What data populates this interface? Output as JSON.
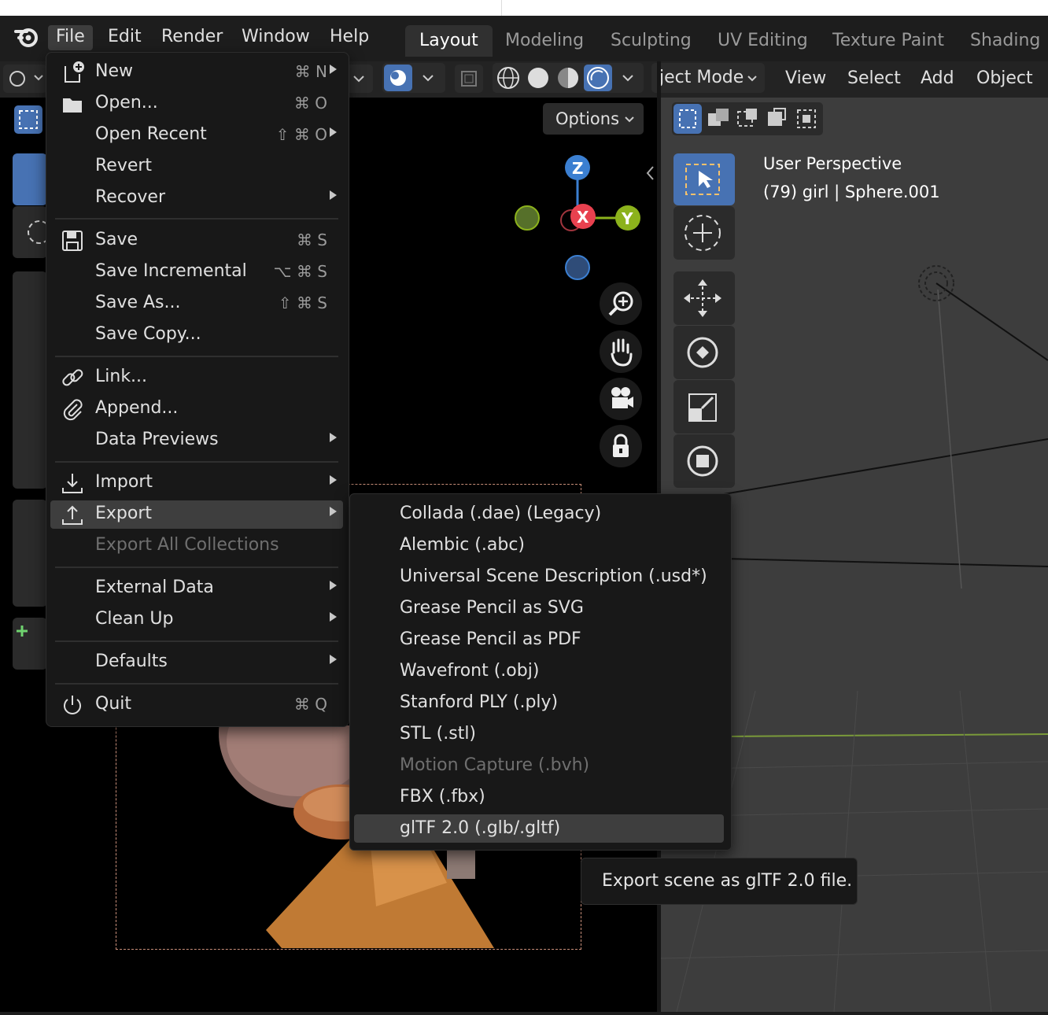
{
  "menubar": {
    "items": [
      "File",
      "Edit",
      "Render",
      "Window",
      "Help"
    ]
  },
  "workspaces": [
    "Layout",
    "Modeling",
    "Sculpting",
    "UV Editing",
    "Texture Paint",
    "Shading"
  ],
  "left_viewport": {
    "options_label": "Options",
    "gizmo": {
      "z": "Z",
      "x": "X",
      "y": "Y"
    }
  },
  "right_viewport": {
    "mode_label": "ject Mode",
    "header_menus": [
      "View",
      "Select",
      "Add",
      "Object"
    ],
    "overlay_line1": "User Perspective",
    "overlay_line2": "(79) girl | Sphere.001"
  },
  "file_menu": {
    "items": [
      {
        "label": "New",
        "shortcut": "⌘ N",
        "icon": "new-file-icon",
        "submenu": true
      },
      {
        "label": "Open...",
        "shortcut": "⌘ O",
        "icon": "folder-icon"
      },
      {
        "label": "Open Recent",
        "shortcut": "⇧ ⌘ O",
        "submenu": true
      },
      {
        "label": "Revert"
      },
      {
        "label": "Recover",
        "submenu": true
      },
      {
        "label": "Save",
        "shortcut": "⌘ S",
        "icon": "save-icon"
      },
      {
        "label": "Save Incremental",
        "shortcut": "⌥ ⌘ S"
      },
      {
        "label": "Save As...",
        "shortcut": "⇧ ⌘ S"
      },
      {
        "label": "Save Copy..."
      },
      {
        "label": "Link...",
        "icon": "link-icon"
      },
      {
        "label": "Append...",
        "icon": "paperclip-icon"
      },
      {
        "label": "Data Previews",
        "submenu": true
      },
      {
        "label": "Import",
        "icon": "import-icon",
        "submenu": true
      },
      {
        "label": "Export",
        "icon": "export-icon",
        "submenu": true,
        "highlighted": true
      },
      {
        "label": "Export All Collections",
        "disabled": true
      },
      {
        "label": "External Data",
        "submenu": true
      },
      {
        "label": "Clean Up",
        "submenu": true
      },
      {
        "label": "Defaults",
        "submenu": true
      },
      {
        "label": "Quit",
        "shortcut": "⌘ Q",
        "icon": "power-icon"
      }
    ]
  },
  "export_submenu": {
    "items": [
      {
        "label": "Collada (.dae) (Legacy)"
      },
      {
        "label": "Alembic (.abc)"
      },
      {
        "label": "Universal Scene Description (.usd*)"
      },
      {
        "label": "Grease Pencil as SVG"
      },
      {
        "label": "Grease Pencil as PDF"
      },
      {
        "label": "Wavefront (.obj)"
      },
      {
        "label": "Stanford PLY (.ply)"
      },
      {
        "label": "STL (.stl)"
      },
      {
        "label": "Motion Capture (.bvh)",
        "disabled": true
      },
      {
        "label": "FBX (.fbx)"
      },
      {
        "label": "glTF 2.0 (.glb/.gltf)",
        "highlighted": true
      }
    ]
  },
  "tooltip": "Export scene as glTF 2.0 file.",
  "colors": {
    "accent": "#4772b3",
    "axis_x": "#e8414f",
    "axis_y": "#8cb21c",
    "axis_z": "#3b7fd1"
  }
}
